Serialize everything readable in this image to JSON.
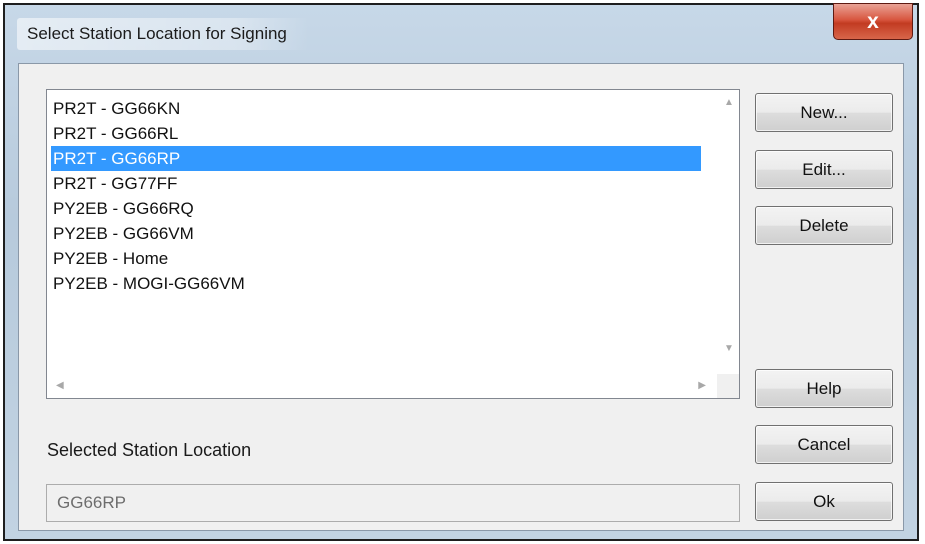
{
  "window": {
    "title": "Select Station Location for Signing",
    "close_label": "x"
  },
  "list": {
    "items": [
      {
        "label": "PR2T - GG66KN",
        "selected": false
      },
      {
        "label": "PR2T - GG66RL",
        "selected": false
      },
      {
        "label": "PR2T - GG66RP",
        "selected": true
      },
      {
        "label": "PR2T - GG77FF",
        "selected": false
      },
      {
        "label": "PY2EB - GG66RQ",
        "selected": false
      },
      {
        "label": "PY2EB - GG66VM",
        "selected": false
      },
      {
        "label": "PY2EB - Home",
        "selected": false
      },
      {
        "label": "PY2EB - MOGI-GG66VM",
        "selected": false
      }
    ]
  },
  "buttons": {
    "new": "New...",
    "edit": "Edit...",
    "delete": "Delete",
    "help": "Help",
    "cancel": "Cancel",
    "ok": "Ok"
  },
  "selected_location": {
    "label": "Selected Station Location",
    "value": "GG66RP"
  },
  "colors": {
    "selection": "#3399ff",
    "close": "#c23b22"
  }
}
